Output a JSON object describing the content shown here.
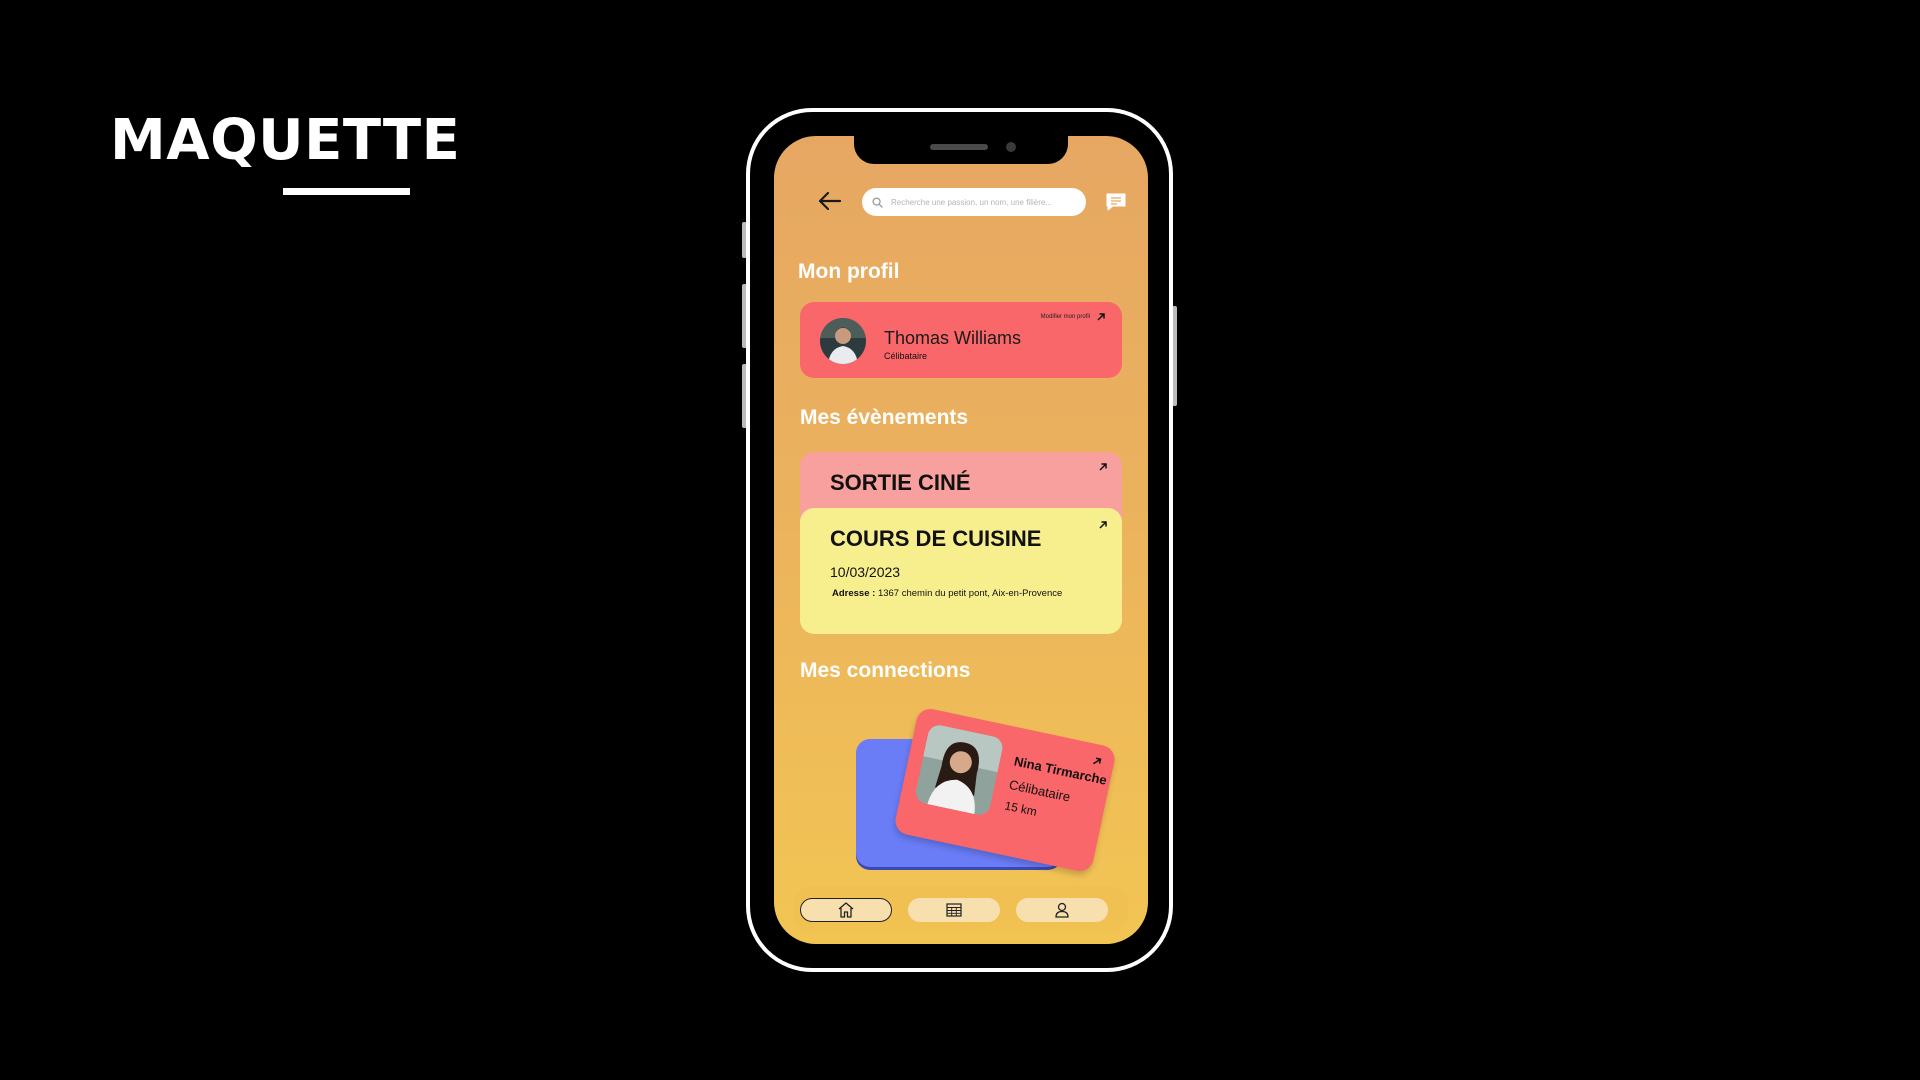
{
  "slide": {
    "title": "MAQUETTE"
  },
  "app": {
    "search": {
      "placeholder": "Recherche une passion, un nom, une filière..."
    },
    "profile_section": {
      "title": "Mon profil",
      "name": "Thomas Williams",
      "status": "Célibataire",
      "edit_label": "Modifier mon profil"
    },
    "events_section": {
      "title": "Mes évènements",
      "events": [
        {
          "title": "SORTIE CINÉ"
        },
        {
          "title": "COURS DE CUISINE",
          "date": "10/03/2023",
          "address_label": "Adresse :",
          "address": "1367 chemin du petit pont, Aix-en-Provence"
        }
      ]
    },
    "connections_section": {
      "title": "Mes connections",
      "connection": {
        "name": "Nina Tirmarche",
        "status": "Célibataire",
        "distance": "15 km"
      }
    },
    "tabbar": {
      "tabs": [
        "home",
        "calendar",
        "profile"
      ],
      "active": "home"
    }
  },
  "colors": {
    "profile_card": "#f9676a",
    "event_cine": "#f7a09d",
    "event_cuisine": "#f7ee8e",
    "connection_back": "#6a7cf6",
    "gradient_top": "#e6a762",
    "gradient_bottom": "#f2c553"
  },
  "icons": [
    "back-arrow-icon",
    "search-icon",
    "chat-icon",
    "arrow-up-right-icon",
    "home-icon",
    "calendar-icon",
    "user-icon"
  ]
}
